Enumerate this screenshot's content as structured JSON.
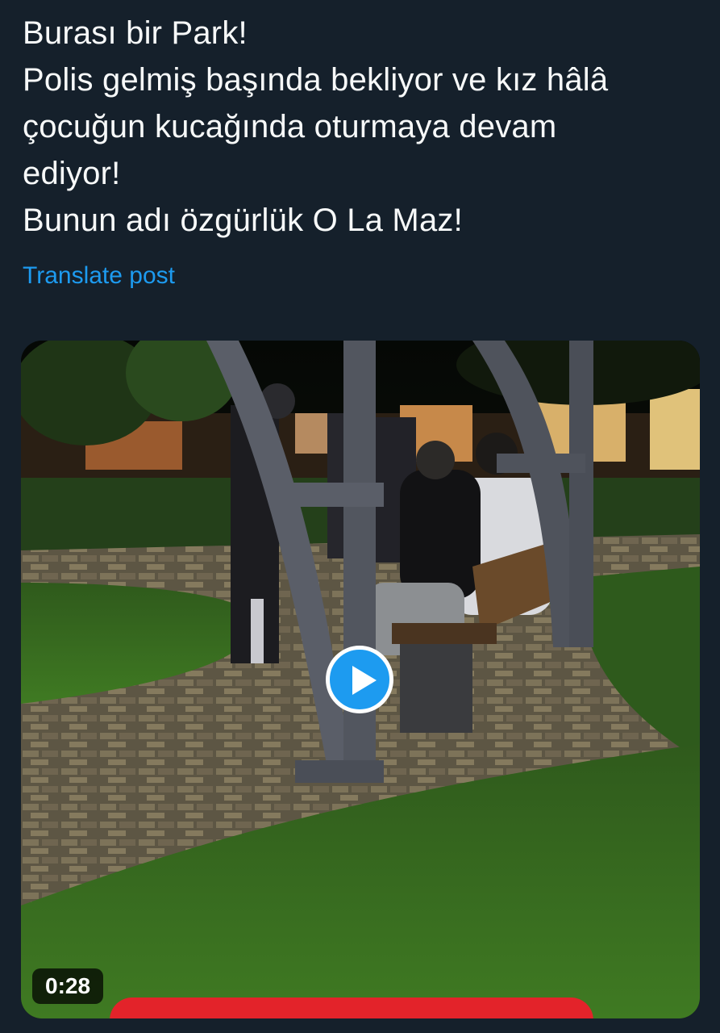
{
  "post": {
    "lines": [
      "Burası bir Park!",
      "Polis gelmiş başında bekliyor ve kız hâlâ",
      "çocuğun kucağında oturmaya devam",
      "ediyor!",
      "Bunun adı özgürlük O La Maz!"
    ],
    "translate_label": "Translate post"
  },
  "media": {
    "duration": "0:28",
    "play_icon": "play-icon"
  },
  "colors": {
    "background": "#15202b",
    "text": "#f7f9f9",
    "link": "#1d9bf0",
    "play_button": "#1d9bf0",
    "banner": "#e3232a"
  }
}
